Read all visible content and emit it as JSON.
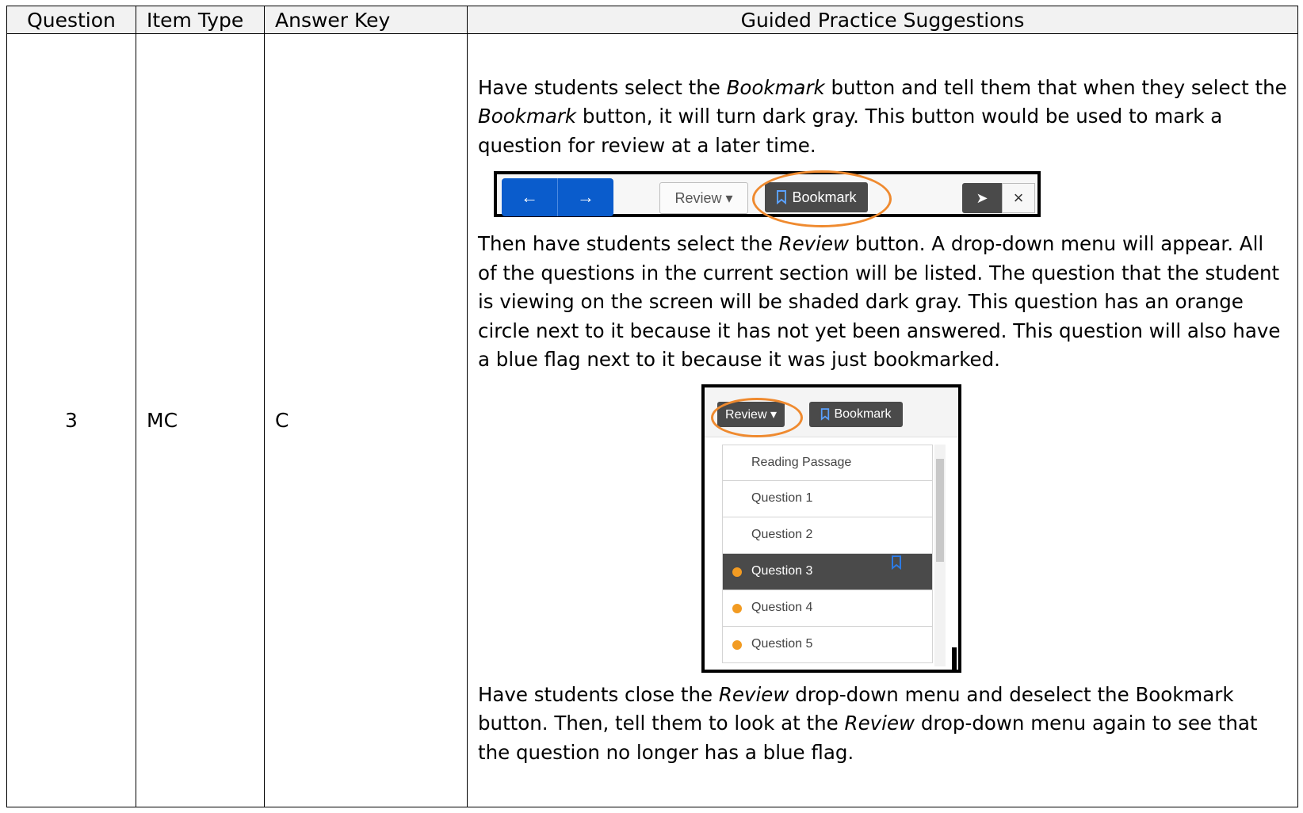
{
  "table": {
    "headers": [
      "Question",
      "Item Type",
      "Answer Key",
      "Guided Practice Suggestions"
    ],
    "row": {
      "question": "3",
      "item_type": "MC",
      "answer_key": "C"
    }
  },
  "guided": {
    "p1": {
      "a": "Have students select the ",
      "b": "Bookmark",
      "c": " button and tell them that when they select the ",
      "d": "Bookmark",
      "e": " button, it will turn dark gray. This button would be used to mark a question for review at a later time."
    },
    "p2": {
      "a": "Then have students select the ",
      "b": "Review",
      "c": " button. A drop-down menu will appear. All of the questions in the current section will be listed. The question that the student is viewing on the screen will be shaded dark gray. This question has an orange circle next to it because it has not yet been answered. This question will also have a blue flag next to it because it was just bookmarked."
    },
    "p3": {
      "a": "Have students close the ",
      "b": "Review",
      "c": " drop-down menu and deselect the Bookmark button. Then, tell them to look at the ",
      "d": "Review",
      "e": " drop-down menu again to see that the question no longer has a blue flag."
    }
  },
  "toolbar_image": {
    "prev_symbol": "←",
    "next_symbol": "→",
    "review_label": "Review ▾",
    "bookmark_label": "Bookmark",
    "pointer_symbol": "➤",
    "close_symbol": "×"
  },
  "review_image": {
    "review_label": "Review ▾",
    "bookmark_label": "Bookmark",
    "items": [
      {
        "label": "Reading Passage",
        "unanswered": false,
        "bookmarked": false,
        "current": false
      },
      {
        "label": "Question 1",
        "unanswered": false,
        "bookmarked": false,
        "current": false
      },
      {
        "label": "Question 2",
        "unanswered": false,
        "bookmarked": false,
        "current": false
      },
      {
        "label": "Question 3",
        "unanswered": true,
        "bookmarked": true,
        "current": true
      },
      {
        "label": "Question 4",
        "unanswered": true,
        "bookmarked": false,
        "current": false
      },
      {
        "label": "Question 5",
        "unanswered": true,
        "bookmarked": false,
        "current": false
      }
    ]
  },
  "colors": {
    "highlight_orange": "#ef8a2f",
    "nav_blue": "#0a5ccc",
    "dark_gray": "#4a4a4a",
    "flag_blue": "#2c7be5",
    "dot_orange": "#f29b22"
  }
}
